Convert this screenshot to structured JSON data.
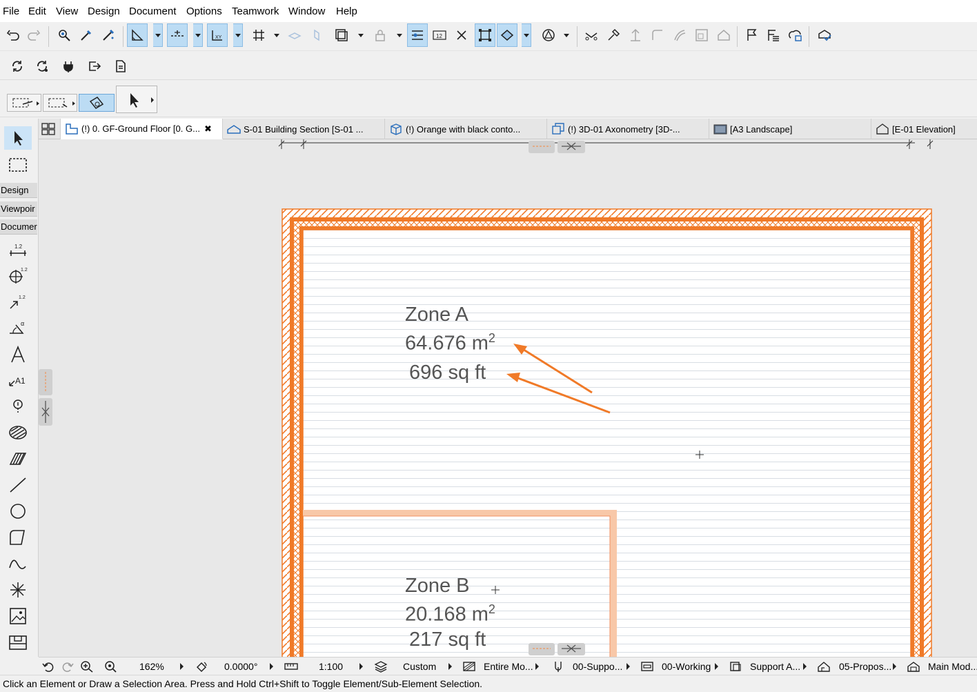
{
  "menu": [
    "File",
    "Edit",
    "View",
    "Design",
    "Document",
    "Options",
    "Teamwork",
    "Window",
    "Help"
  ],
  "tabs": [
    {
      "label": "(!) 0. GF-Ground Floor [0. G...",
      "icon": "floor-plan-icon",
      "active": true,
      "close": "✖"
    },
    {
      "label": "S-01 Building Section [S-01 ...",
      "icon": "section-icon"
    },
    {
      "label": "(!) Orange with black conto...",
      "icon": "3d-cube-icon"
    },
    {
      "label": "(!) 3D-01 Axonometry [3D-...",
      "icon": "axonometry-icon"
    },
    {
      "label": "[A3 Landscape]",
      "icon": "layout-icon"
    },
    {
      "label": "[E-01 Elevation]",
      "icon": "elevation-icon"
    }
  ],
  "toolbox": {
    "groups": [
      "Design",
      "Viewpoir",
      "Documer"
    ],
    "tools": [
      "arrow-icon",
      "marquee-icon",
      "dimension-icon",
      "radial-dimension-icon",
      "level-dimension-icon",
      "angle-dimension-icon",
      "text-icon",
      "label-icon",
      "marker-icon",
      "fill-icon",
      "hatch-icon",
      "line-icon",
      "circle-icon",
      "polyline-icon",
      "spline-icon",
      "hotspot-icon",
      "figure-icon",
      "drawing-icon"
    ]
  },
  "drawing": {
    "zone_a": {
      "name": "Zone A",
      "area_m": "64.676 m",
      "area_sup": "2",
      "area_ft": "696 sq ft"
    },
    "zone_b": {
      "name": "Zone B",
      "area_m": "20.168 m",
      "area_sup": "2",
      "area_ft": "217 sq ft"
    },
    "wall_color": "#f07a28",
    "partition_color": "#f8c8a8",
    "annotation_color": "#f07a28"
  },
  "status": {
    "zoom": "162%",
    "angle": "0.0000°",
    "scale": "1:100",
    "layer_combo": "Custom",
    "model_view": "Entire Mo...",
    "pen_set": "00-Suppo...",
    "renovation": "00-Working",
    "support": "Support A...",
    "proposed": "05-Propos...",
    "main_model": "Main Mod..."
  },
  "hint": "Click an Element or Draw a Selection Area. Press and Hold Ctrl+Shift to Toggle Element/Sub-Element Selection."
}
